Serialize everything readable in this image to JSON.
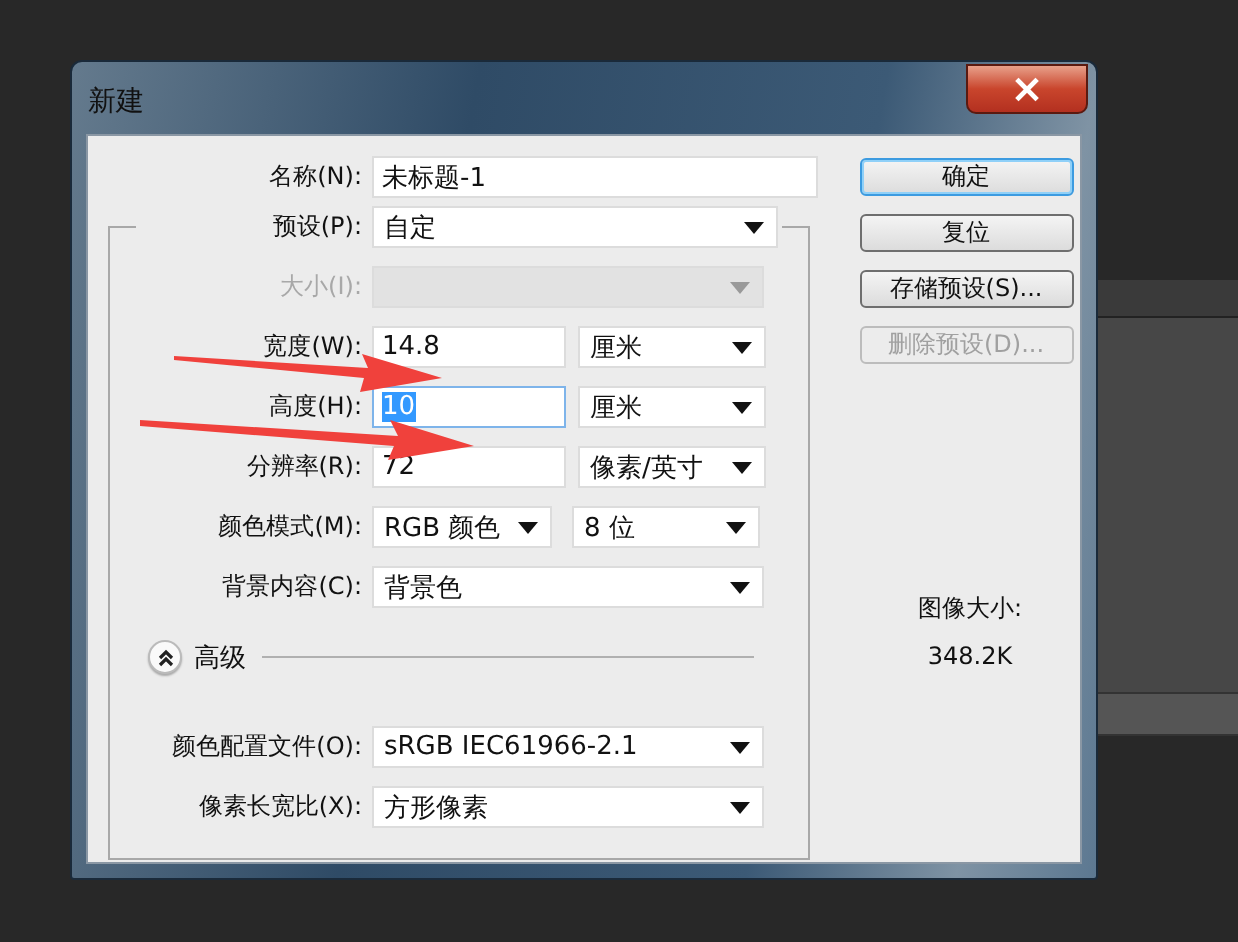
{
  "window": {
    "title": "新建",
    "close": "×"
  },
  "name": {
    "label": "名称(N):",
    "value": "未标题-1"
  },
  "rows": [
    {
      "kind": "select",
      "label": "预设(P):",
      "value": "自定",
      "disabled": false
    },
    {
      "kind": "select",
      "label": "大小(I):",
      "disabled": true
    },
    {
      "kind": "input_unit",
      "label": "宽度(W):",
      "value": "14.8",
      "unit": "厘米",
      "selected": false
    },
    {
      "kind": "input_unit",
      "label": "高度(H):",
      "value": "10",
      "unit": "厘米",
      "selected": true
    },
    {
      "kind": "input_unit",
      "label": "分辨率(R):",
      "value": "72",
      "unit": "像素/英寸",
      "selected": false
    },
    {
      "kind": "select_pair",
      "label": "颜色模式(M):",
      "value": "RGB 颜色",
      "unit": "8 位"
    },
    {
      "kind": "select",
      "label": "背景内容(C):",
      "value": "背景色",
      "disabled": false
    }
  ],
  "advanced": {
    "label": "高级",
    "expanded": true,
    "rows": [
      {
        "label": "颜色配置文件(O):",
        "value": "sRGB IEC61966-2.1",
        "disabled": false
      },
      {
        "label": "像素长宽比(X):",
        "value": "方形像素",
        "disabled": false
      }
    ]
  },
  "buttons": [
    {
      "label": "确定",
      "default": true,
      "disabled": false
    },
    {
      "label": "复位",
      "default": false,
      "disabled": false
    },
    {
      "label": "存储预设(S)...",
      "default": false,
      "disabled": false
    },
    {
      "label": "删除预设(D)...",
      "default": false,
      "disabled": true
    }
  ],
  "image_size": {
    "label": "图像大小:",
    "value": "348.2K"
  }
}
